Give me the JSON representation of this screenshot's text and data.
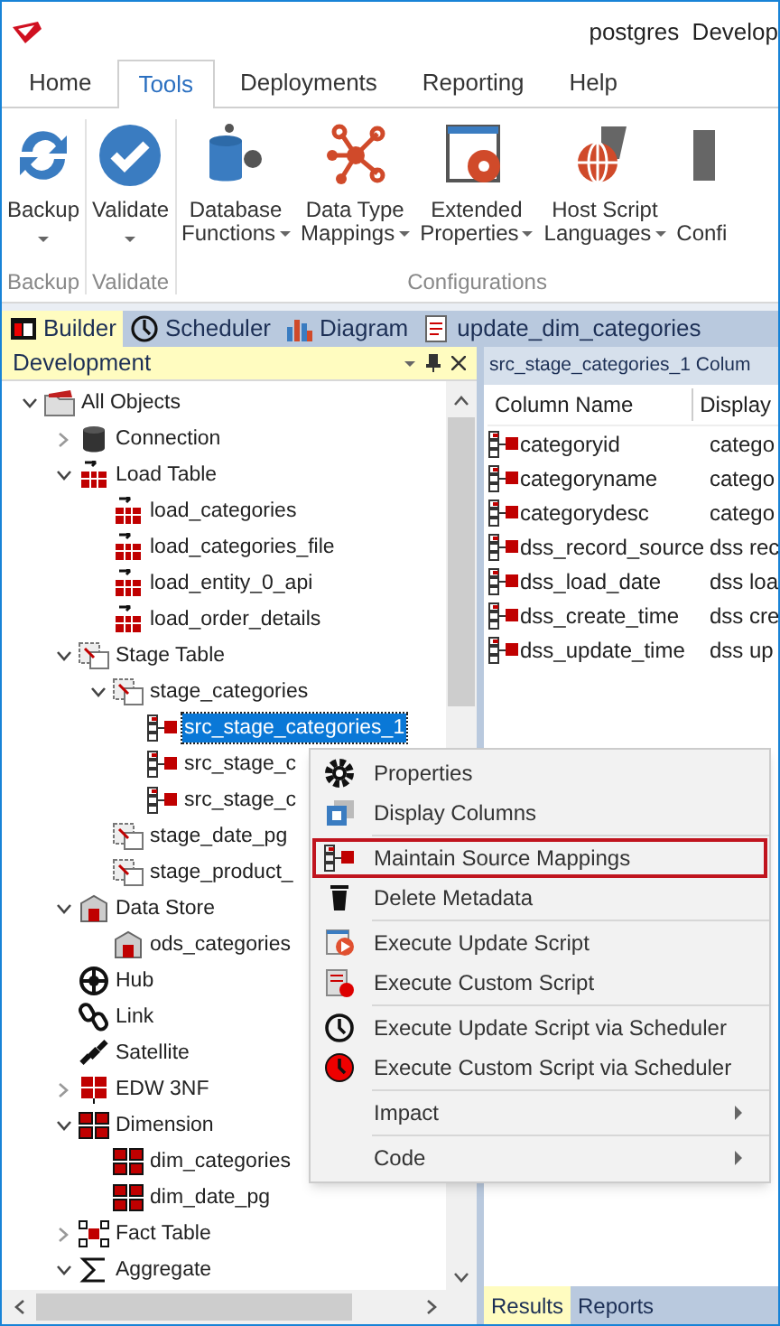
{
  "window": {
    "title": "postgres  Develop"
  },
  "ribbon_tabs": [
    {
      "label": "Home",
      "selected": false
    },
    {
      "label": "Tools",
      "selected": true
    },
    {
      "label": "Deployments",
      "selected": false
    },
    {
      "label": "Reporting",
      "selected": false
    },
    {
      "label": "Help",
      "selected": false
    }
  ],
  "ribbon_groups": [
    {
      "label": "Backup",
      "buttons": [
        {
          "kind": "backup",
          "lines": [
            "Backup"
          ],
          "dropdown": true
        }
      ]
    },
    {
      "label": "Validate",
      "buttons": [
        {
          "kind": "validate",
          "lines": [
            "Validate"
          ],
          "dropdown": true
        }
      ]
    },
    {
      "label": "Configurations",
      "buttons": [
        {
          "kind": "database",
          "lines": [
            "Database",
            "Functions"
          ],
          "dropdown": true
        },
        {
          "kind": "mappings",
          "lines": [
            "Data Type",
            "Mappings"
          ],
          "dropdown": true
        },
        {
          "kind": "properties",
          "lines": [
            "Extended",
            "Properties"
          ],
          "dropdown": true
        },
        {
          "kind": "languages",
          "lines": [
            "Host Script",
            "Languages"
          ],
          "dropdown": true
        },
        {
          "kind": "config",
          "lines": [
            "Confi"
          ]
        }
      ]
    }
  ],
  "doc_tabs": [
    {
      "kind": "builder",
      "label": "Builder",
      "selected": true
    },
    {
      "kind": "scheduler",
      "label": "Scheduler",
      "selected": false
    },
    {
      "kind": "diagram",
      "label": "Diagram",
      "selected": false
    },
    {
      "kind": "script",
      "label": "update_dim_categories",
      "selected": false
    }
  ],
  "tree_panel": {
    "title": "Development",
    "items": [
      {
        "kind": "folder",
        "label": "All Objects",
        "expanded": true,
        "children": [
          {
            "kind": "connection",
            "label": "Connection",
            "expanded": false
          },
          {
            "kind": "load",
            "label": "Load Table",
            "expanded": true,
            "children": [
              {
                "kind": "load",
                "label": "load_categories"
              },
              {
                "kind": "load",
                "label": "load_categories_file"
              },
              {
                "kind": "load",
                "label": "load_entity_0_api"
              },
              {
                "kind": "load",
                "label": "load_order_details"
              }
            ]
          },
          {
            "kind": "stage",
            "label": "Stage Table",
            "expanded": true,
            "children": [
              {
                "kind": "stage",
                "label": "stage_categories",
                "expanded": true,
                "children": [
                  {
                    "kind": "source",
                    "label": "src_stage_categories_1",
                    "selected": true
                  },
                  {
                    "kind": "source",
                    "label": "src_stage_c",
                    "selected": false
                  },
                  {
                    "kind": "source",
                    "label": "src_stage_c",
                    "selected": false
                  }
                ]
              },
              {
                "kind": "stage",
                "label": "stage_date_pg"
              },
              {
                "kind": "stage",
                "label": "stage_product_"
              }
            ]
          },
          {
            "kind": "datastore",
            "label": "Data Store",
            "expanded": true,
            "children": [
              {
                "kind": "datastore",
                "label": "ods_categories"
              }
            ]
          },
          {
            "kind": "hub",
            "label": "Hub"
          },
          {
            "kind": "link",
            "label": "Link"
          },
          {
            "kind": "satellite",
            "label": "Satellite"
          },
          {
            "kind": "edw",
            "label": "EDW 3NF",
            "expanded": false
          },
          {
            "kind": "dimension",
            "label": "Dimension",
            "expanded": true,
            "children": [
              {
                "kind": "dimension",
                "label": "dim_categories"
              },
              {
                "kind": "dimension",
                "label": "dim_date_pg"
              }
            ]
          },
          {
            "kind": "fact",
            "label": "Fact Table",
            "expanded": false
          },
          {
            "kind": "aggregate",
            "label": "Aggregate",
            "expanded": true
          }
        ]
      }
    ]
  },
  "columns_panel": {
    "title": "src_stage_categories_1 Colum",
    "columns": [
      "Column Name",
      "Display"
    ],
    "rows": [
      [
        "categoryid",
        "catego"
      ],
      [
        "categoryname",
        "catego"
      ],
      [
        "categorydesc",
        "catego"
      ],
      [
        "dss_record_source",
        "dss rec"
      ],
      [
        "dss_load_date",
        "dss loa"
      ],
      [
        "dss_create_time",
        "dss cre"
      ],
      [
        "dss_update_time",
        "dss up"
      ]
    ],
    "bottom_tabs": [
      {
        "label": "Results",
        "selected": true
      },
      {
        "label": "Reports",
        "selected": false
      }
    ]
  },
  "context_menu": [
    {
      "kind": "item",
      "label": "Properties",
      "selected": false
    },
    {
      "kind": "item",
      "label": "Display Columns",
      "selected": false
    },
    {
      "kind": "separator"
    },
    {
      "kind": "item",
      "label": "Maintain Source Mappings",
      "selected": true
    },
    {
      "kind": "item",
      "label": "Delete Metadata",
      "selected": false
    },
    {
      "kind": "separator"
    },
    {
      "kind": "item",
      "label": "Execute Update Script",
      "selected": false
    },
    {
      "kind": "item",
      "label": "Execute Custom Script",
      "selected": false
    },
    {
      "kind": "separator"
    },
    {
      "kind": "item",
      "label": "Execute Update Script via Scheduler",
      "selected": false
    },
    {
      "kind": "item",
      "label": "Execute Custom Script via Scheduler",
      "selected": false
    },
    {
      "kind": "separator"
    },
    {
      "kind": "submenu",
      "label": "Impact",
      "selected": false
    },
    {
      "kind": "separator"
    },
    {
      "kind": "submenu",
      "label": "Code",
      "selected": false
    }
  ]
}
